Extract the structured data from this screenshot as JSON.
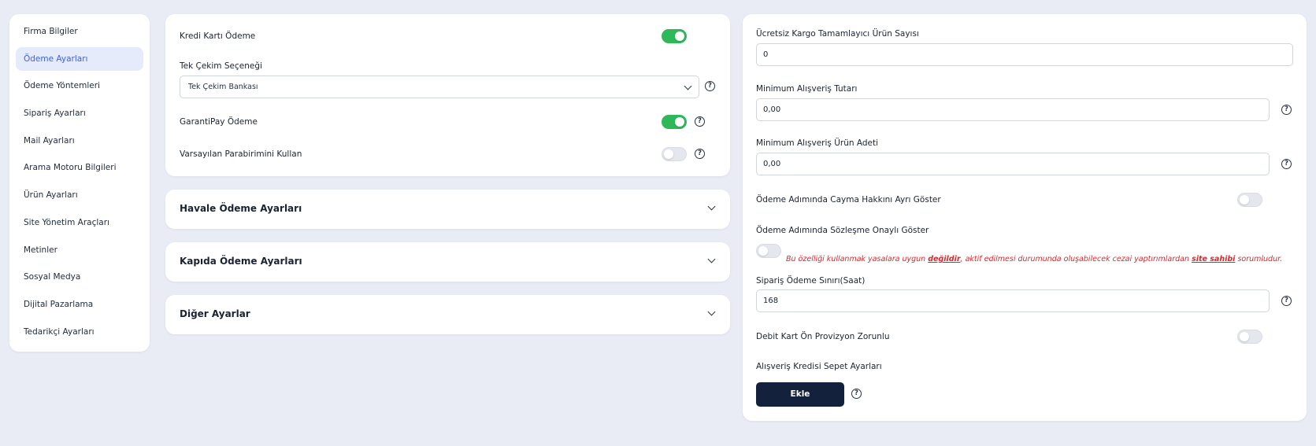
{
  "sidebar": {
    "items": [
      {
        "label": "Firma Bilgiler"
      },
      {
        "label": "Ödeme Ayarları"
      },
      {
        "label": "Ödeme Yöntemleri"
      },
      {
        "label": "Sipariş Ayarları"
      },
      {
        "label": "Mail Ayarları"
      },
      {
        "label": "Arama Motoru Bilgileri"
      },
      {
        "label": "Ürün Ayarları"
      },
      {
        "label": "Site Yönetim Araçları"
      },
      {
        "label": "Metinler"
      },
      {
        "label": "Sosyal Medya"
      },
      {
        "label": "Dijital Pazarlama"
      },
      {
        "label": "Tedarikçi Ayarları"
      }
    ],
    "active": "Ödeme Ayarları"
  },
  "kredi": {
    "kredi_karti_label": "Kredi Kartı Ödeme",
    "kredi_karti_on": true,
    "tek_cekim_label": "Tek Çekim Seçeneği",
    "tek_cekim_value": "Tek Çekim Bankası",
    "garantipay_label": "GarantiPay Ödeme",
    "garantipay_on": true,
    "varsayilan_label": "Varsayılan Parabirimini Kullan",
    "varsayilan_on": false
  },
  "accordions": [
    {
      "title": "Havale Ödeme Ayarları"
    },
    {
      "title": "Kapıda Ödeme Ayarları"
    },
    {
      "title": "Diğer Ayarlar"
    }
  ],
  "right": {
    "ucretsiz_label": "Ücretsiz Kargo Tamamlayıcı Ürün Sayısı",
    "ucretsiz_value": "0",
    "min_tutar_label": "Minimum Alışveriş Tutarı",
    "min_tutar_value": "0,00",
    "min_adet_label": "Minimum Alışveriş Ürün Adeti",
    "min_adet_value": "0,00",
    "cayma_label": "Ödeme Adımında Cayma Hakkını Ayrı Göster",
    "cayma_on": false,
    "sozlesme_label": "Ödeme Adımında Sözleşme Onaylı Göster",
    "sozlesme_on": false,
    "warning_part1": "Bu özelliği kullanmak yasalara uygun ",
    "warning_bold1": "değildir",
    "warning_part2": ", aktif edilmesi durumunda oluşabilecek cezai yaptırımlardan ",
    "warning_bold2": "site sahibi",
    "warning_part3": " sorumludur.",
    "siparis_label": "Sipariş Ödeme Sınırı(Saat)",
    "siparis_value": "168",
    "debit_label": "Debit Kart Ön Provizyon Zorunlu",
    "debit_on": false,
    "alisveris_label": "Alışveriş Kredisi Sepet Ayarları",
    "ekle_label": "Ekle"
  },
  "help_glyph": "?",
  "colors": {
    "background": "#e9ecf5",
    "active_bg": "#e6ebfb",
    "active_text": "#3e63dd",
    "toggle_on": "#2fb85a",
    "button_bg": "#13213d",
    "warning": "#e0252b"
  }
}
